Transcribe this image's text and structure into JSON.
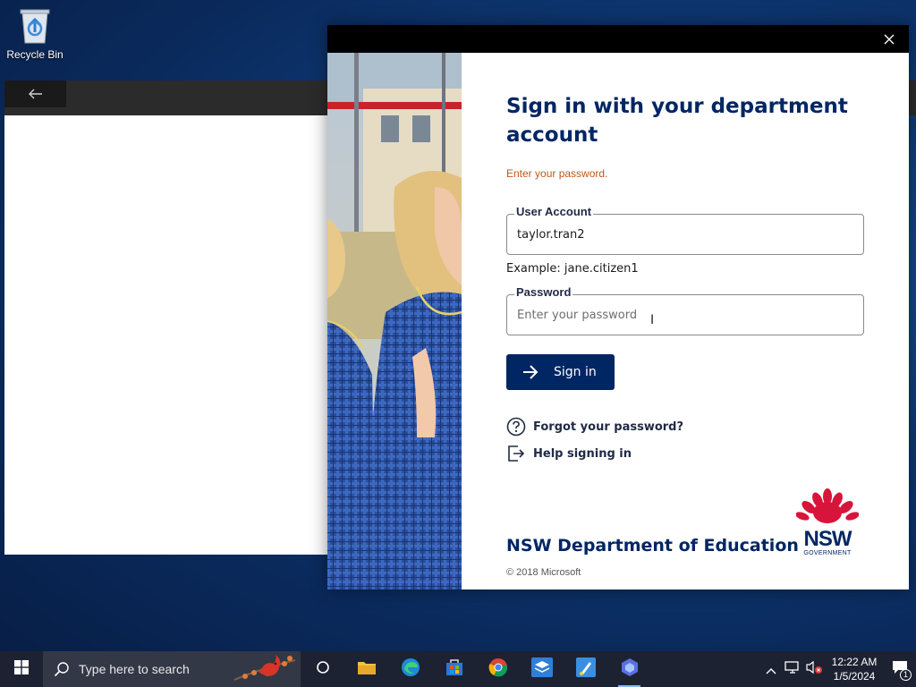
{
  "desktop": {
    "recycle_bin_label": "Recycle Bin"
  },
  "dialog": {
    "title": "Sign in with your department account",
    "hint": "Enter your password.",
    "user_field": {
      "label": "User Account",
      "value": "taylor.tran2"
    },
    "example_text": "Example: jane.citizen1",
    "password_field": {
      "label": "Password",
      "placeholder": "Enter your password"
    },
    "signin_label": "Sign in",
    "forgot_label": "Forgot your password?",
    "help_label": "Help signing in",
    "org_name": "NSW Department of Education",
    "copyright": "© 2018 Microsoft",
    "logo": {
      "nsw": "NSW",
      "government": "GOVERNMENT"
    }
  },
  "taskbar": {
    "search_placeholder": "Type here to search",
    "apps": [
      "task-view-icon",
      "file-explorer-icon",
      "edge-icon",
      "store-icon",
      "chrome-icon",
      "app-blue-icon",
      "paint-icon",
      "copilot-icon"
    ],
    "time": "12:22 AM",
    "date": "1/5/2024",
    "notification_count": "1"
  },
  "colors": {
    "brand_navy": "#002664",
    "hint_orange": "#c0571c",
    "nsw_red": "#d7153a"
  }
}
